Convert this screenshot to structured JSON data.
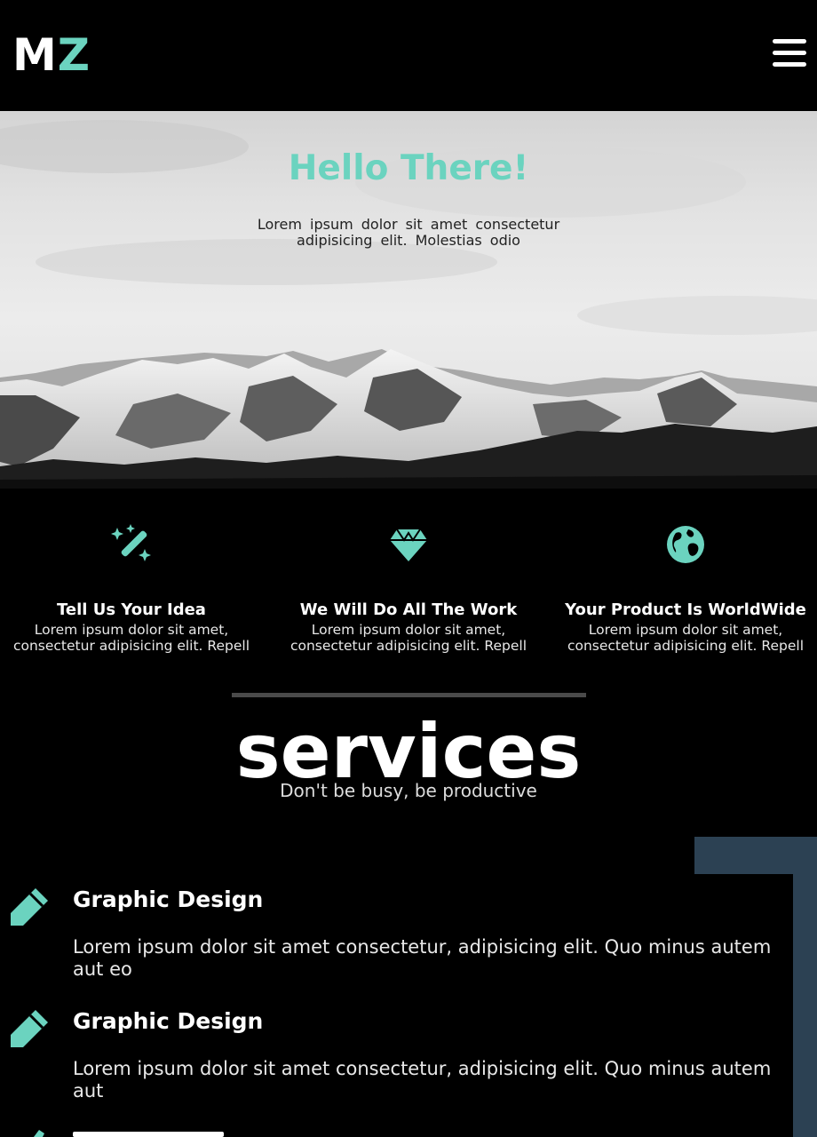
{
  "header": {
    "logo_primary": "M",
    "logo_accent": "Z",
    "menu_icon": "hamburger-menu-icon"
  },
  "hero": {
    "title": "Hello There!",
    "text_line1": "Lorem ipsum dolor sit amet consectetur",
    "text_line2": "adipisicing elit. Molestias odio"
  },
  "features": [
    {
      "icon": "magic-wand-icon",
      "title": "Tell Us Your Idea",
      "text_line1": "Lorem ipsum dolor sit amet,",
      "text_line2": "consectetur adipisicing elit. Repell"
    },
    {
      "icon": "diamond-icon",
      "title": "We Will Do All The Work",
      "text_line1": "Lorem ipsum dolor sit amet,",
      "text_line2": "consectetur adipisicing elit. Repell"
    },
    {
      "icon": "globe-icon",
      "title": "Your Product Is WorldWide",
      "text_line1": "Lorem ipsum dolor sit amet,",
      "text_line2": "consectetur adipisicing elit. Repell"
    }
  ],
  "services": {
    "title": "services",
    "subtitle": "Don't be busy, be productive",
    "items": [
      {
        "icon": "pencil-icon",
        "title": "Graphic Design",
        "text_line1": "Lorem ipsum dolor sit amet consectetur, adipisicing elit. Quo minus autem",
        "text_line2": "aut eo"
      },
      {
        "icon": "pencil-icon",
        "title": "Graphic Design",
        "text_line1": "Lorem ipsum dolor sit amet consectetur, adipisicing elit. Quo minus autem",
        "text_line2": "aut"
      }
    ]
  },
  "colors": {
    "accent": "#6bd3bf",
    "background": "#000000",
    "frame": "#2c4153"
  }
}
